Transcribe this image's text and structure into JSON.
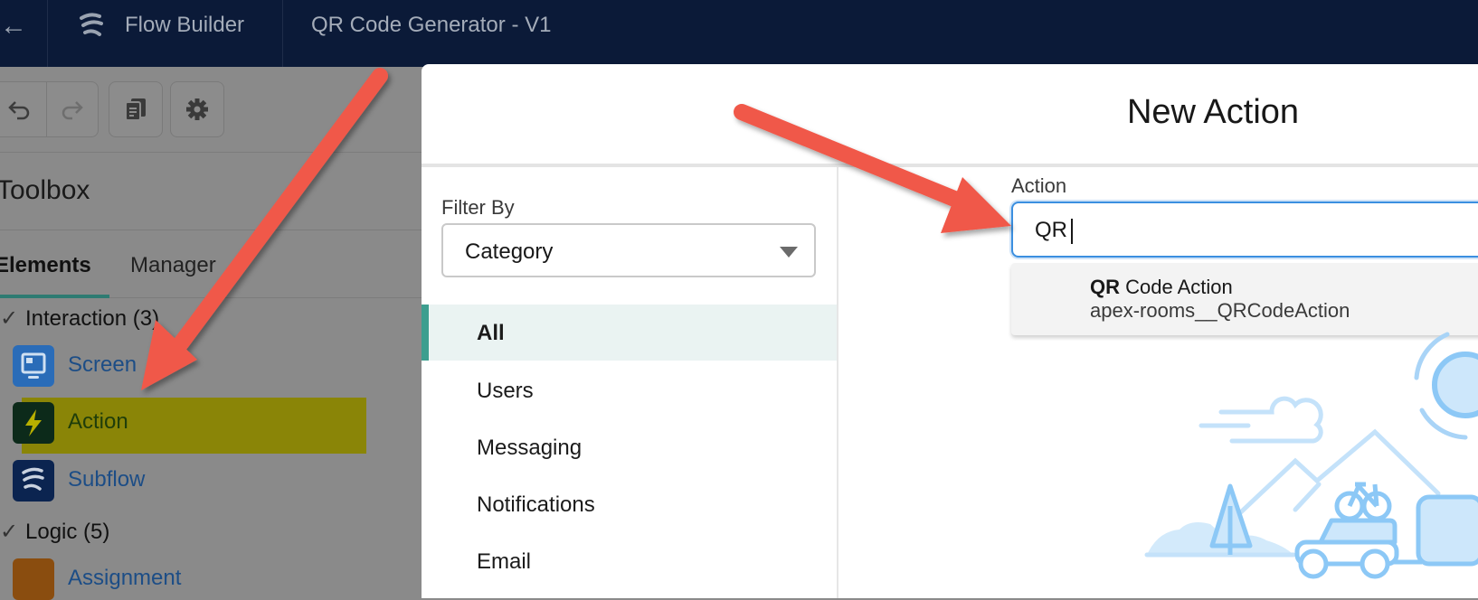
{
  "topbar": {
    "app_name": "Flow Builder",
    "flow_name": "QR Code Generator - V1"
  },
  "toolbar": {
    "buttons": [
      "undo-icon",
      "redo-icon",
      "copy-icon",
      "gear-icon"
    ]
  },
  "toolbox": {
    "title": "Toolbox",
    "tabs": [
      {
        "label": "Elements",
        "active": true
      },
      {
        "label": "Manager",
        "active": false
      }
    ],
    "sections": [
      {
        "label": "Interaction (3)",
        "items": [
          {
            "label": "Screen",
            "icon": "screen-icon",
            "color": "#2a6cb8"
          },
          {
            "label": "Action",
            "icon": "lightning-bolt-icon",
            "color": "#0c2a48",
            "highlighted": true
          },
          {
            "label": "Subflow",
            "icon": "flow-icon",
            "color": "#0b2450"
          }
        ]
      },
      {
        "label": "Logic (5)",
        "items": [
          {
            "label": "Assignment",
            "icon": "assignment-icon",
            "color": "#8a4d0f"
          }
        ]
      }
    ]
  },
  "modal": {
    "title": "New Action",
    "filter": {
      "label": "Filter By",
      "selected": "Category"
    },
    "categories": [
      {
        "label": "All",
        "active": true
      },
      {
        "label": "Users",
        "active": false
      },
      {
        "label": "Messaging",
        "active": false
      },
      {
        "label": "Notifications",
        "active": false
      },
      {
        "label": "Email",
        "active": false
      }
    ],
    "action_field": {
      "label": "Action",
      "value": "QR"
    },
    "suggestion": {
      "match": "QR",
      "rest": " Code Action",
      "api_name": "apex-rooms__QRCodeAction"
    }
  },
  "colors": {
    "topbar": "#0b1a38",
    "accent": "#3d9e8f",
    "focus": "#3b8fe0",
    "arrow": "#f0584a",
    "highlight": "#8a8500"
  }
}
